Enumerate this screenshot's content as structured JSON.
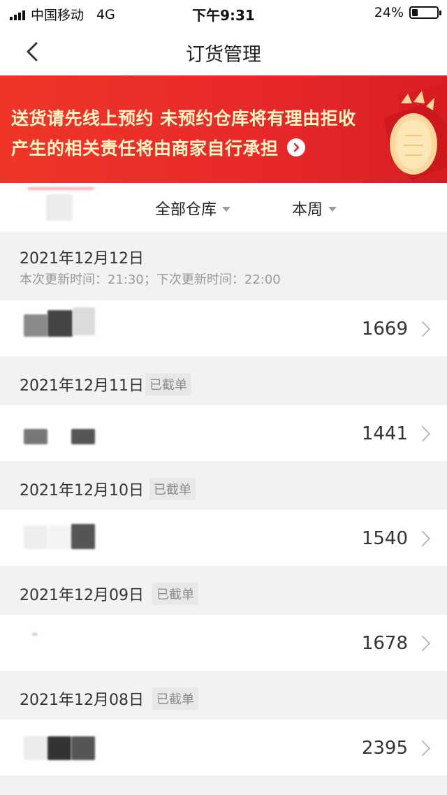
{
  "status_bar": {
    "carrier": "中国移动",
    "network": "4G",
    "time": "下午9:31",
    "battery_text": "24%",
    "battery_level": 0.24
  },
  "nav": {
    "title": "订货管理",
    "back_icon": "chevron-left-icon"
  },
  "banner": {
    "line1": "送货请先线上预约  未预约仓库将有理由拒收",
    "line2": "产生的相关责任将由商家自行承担",
    "arrow_icon": "chevron-right-circle-icon",
    "bg_color": "#e7282a",
    "text_color": "#fff6c8"
  },
  "filters": {
    "warehouse": "全部仓库",
    "period": "本周"
  },
  "groups": [
    {
      "date": "2021年12月12日",
      "badge": "",
      "update_info": "本次更新时间：21:30；下次更新时间：22:00",
      "amount": "1669"
    },
    {
      "date": "2021年12月11日",
      "badge": "已截单",
      "update_info": "",
      "amount": "1441"
    },
    {
      "date": "2021年12月10日",
      "badge": "已截单",
      "update_info": "",
      "amount": "1540"
    },
    {
      "date": "2021年12月09日",
      "badge": "已截单",
      "update_info": "",
      "amount": "1678"
    },
    {
      "date": "2021年12月08日",
      "badge": "已截单",
      "update_info": "",
      "amount": "2395"
    }
  ]
}
